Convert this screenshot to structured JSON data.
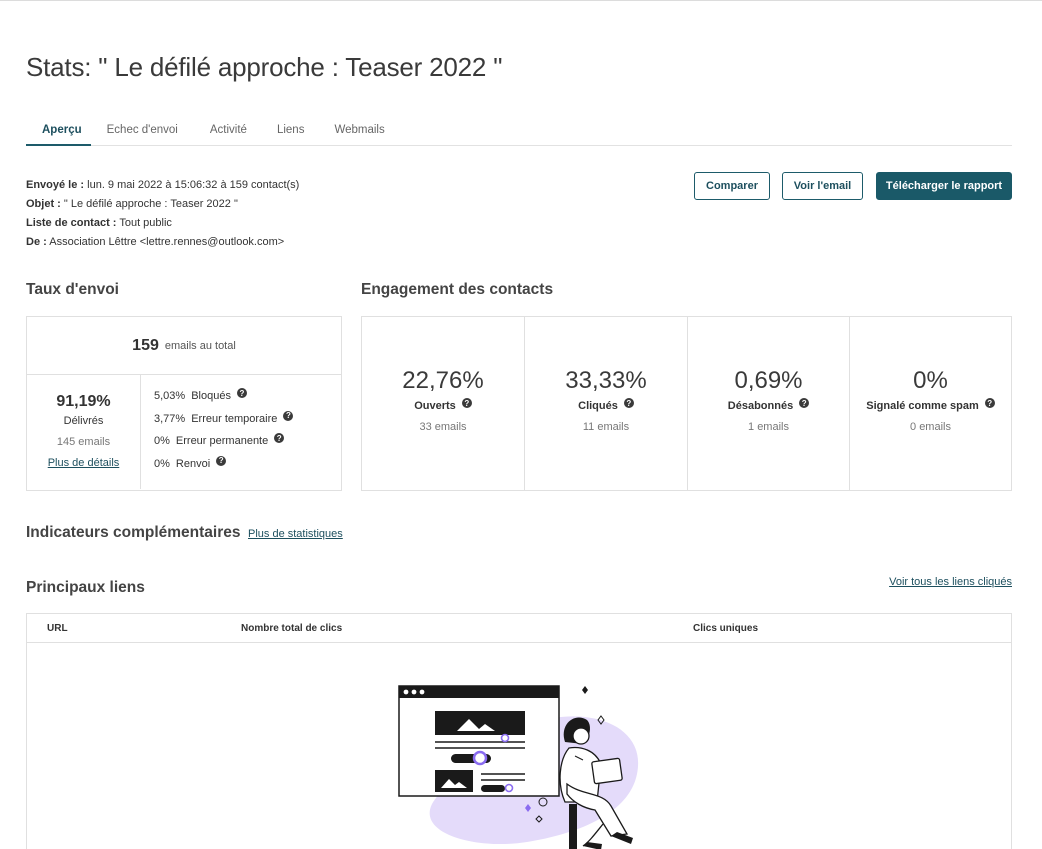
{
  "page": {
    "title": "Stats: \" Le défilé approche : Teaser 2022 \""
  },
  "tabs": [
    {
      "label": "Aperçu",
      "active": true
    },
    {
      "label": "Echec d'envoi",
      "active": false
    },
    {
      "label": "Activité",
      "active": false
    },
    {
      "label": "Liens",
      "active": false
    },
    {
      "label": "Webmails",
      "active": false
    }
  ],
  "info": {
    "sent_label": "Envoyé le :",
    "sent_value": "lun. 9 mai 2022 à 15:06:32 à 159 contact(s)",
    "subject_label": "Objet :",
    "subject_value": "\" Le défilé approche : Teaser 2022 \"",
    "list_label": "Liste de contact :",
    "list_value": "Tout public",
    "from_label": "De :",
    "from_value": "Association Lêttre <lettre.rennes@outlook.com>"
  },
  "actions": {
    "compare": "Comparer",
    "view_email": "Voir l'email",
    "download": "Télécharger le rapport"
  },
  "taux": {
    "title": "Taux d'envoi",
    "total": "159",
    "total_label": "emails au total",
    "delivered_pct": "91,19%",
    "delivered_label": "Délivrés",
    "delivered_count": "145 emails",
    "details_link": "Plus de détails",
    "errors": [
      {
        "pct": "5,03%",
        "label": "Bloqués"
      },
      {
        "pct": "3,77%",
        "label": "Erreur temporaire"
      },
      {
        "pct": "0%",
        "label": "Erreur permanente"
      },
      {
        "pct": "0%",
        "label": "Renvoi"
      }
    ]
  },
  "engagement": {
    "title": "Engagement des contacts",
    "items": [
      {
        "pct": "22,76%",
        "label": "Ouverts",
        "count": "33 emails"
      },
      {
        "pct": "33,33%",
        "label": "Cliqués",
        "count": "11 emails"
      },
      {
        "pct": "0,69%",
        "label": "Désabonnés",
        "count": "1 emails"
      },
      {
        "pct": "0%",
        "label": "Signalé comme spam",
        "count": "0 emails"
      }
    ]
  },
  "indicators": {
    "title": "Indicateurs complémentaires",
    "link": "Plus de statistiques"
  },
  "links": {
    "title": "Principaux liens",
    "view_all": "Voir tous les liens cliqués",
    "columns": [
      "URL",
      "Nombre total de clics",
      "Clics uniques"
    ]
  },
  "icons": {
    "help": "question-circle-icon"
  },
  "colors": {
    "primary": "#1a5968",
    "accent_purple": "#8a6cf0",
    "illustration_blob": "#e4dbfa"
  }
}
